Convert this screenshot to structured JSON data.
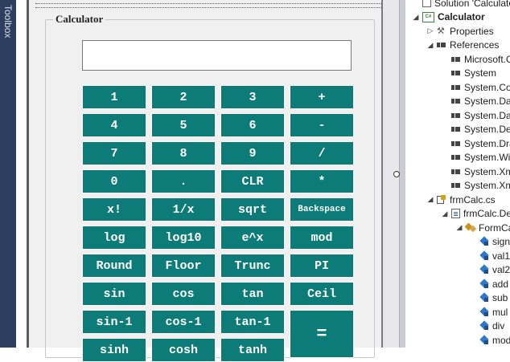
{
  "toolbox": {
    "label": "Toolbox"
  },
  "form": {
    "group_title": "Calculator",
    "display_value": "",
    "button_color": "#0d7b78",
    "buttons": [
      [
        "1",
        "2",
        "3",
        "+"
      ],
      [
        "4",
        "5",
        "6",
        "-"
      ],
      [
        "7",
        "8",
        "9",
        "/"
      ],
      [
        "0",
        ".",
        "CLR",
        "*"
      ],
      [
        "x!",
        "1/x",
        "sqrt",
        "Backspace"
      ],
      [
        "log",
        "log10",
        "e^x",
        "mod"
      ],
      [
        "Round",
        "Floor",
        "Trunc",
        "PI"
      ],
      [
        "sin",
        "cos",
        "tan",
        "Ceil"
      ],
      [
        "sin-1",
        "cos-1",
        "tan-1",
        "="
      ],
      [
        "sinh",
        "cosh",
        "tanh"
      ]
    ]
  },
  "solution_explorer": {
    "items": [
      {
        "label": "Solution 'Calculator'",
        "icon": "solution-icon",
        "indent": 0,
        "expander": ""
      },
      {
        "label": "Calculator",
        "icon": "csharp-project-icon",
        "project_badge": "C#",
        "indent": 0,
        "expander": "open",
        "bold": true
      },
      {
        "label": "Properties",
        "icon": "wrench-icon",
        "indent": 1,
        "expander": "closed"
      },
      {
        "label": "References",
        "icon": "reference-icon",
        "indent": 1,
        "expander": "open"
      },
      {
        "label": "Microsoft.CSharp",
        "icon": "reference-icon",
        "indent": 2,
        "expander": ""
      },
      {
        "label": "System",
        "icon": "reference-icon",
        "indent": 2,
        "expander": ""
      },
      {
        "label": "System.Core",
        "icon": "reference-icon",
        "indent": 2,
        "expander": ""
      },
      {
        "label": "System.Data",
        "icon": "reference-icon",
        "indent": 2,
        "expander": ""
      },
      {
        "label": "System.Data.DataSetExtensions",
        "icon": "reference-icon",
        "indent": 2,
        "expander": ""
      },
      {
        "label": "System.Deployment",
        "icon": "reference-icon",
        "indent": 2,
        "expander": ""
      },
      {
        "label": "System.Drawing",
        "icon": "reference-icon",
        "indent": 2,
        "expander": ""
      },
      {
        "label": "System.Windows.Forms",
        "icon": "reference-icon",
        "indent": 2,
        "expander": ""
      },
      {
        "label": "System.Xml",
        "icon": "reference-icon",
        "indent": 2,
        "expander": ""
      },
      {
        "label": "System.Xml.Linq",
        "icon": "reference-icon",
        "indent": 2,
        "expander": ""
      },
      {
        "label": "frmCalc.cs",
        "icon": "form-file-icon",
        "indent": 1,
        "expander": "open"
      },
      {
        "label": "frmCalc.Designer.cs",
        "icon": "code-file-icon",
        "indent": 2,
        "expander": "open"
      },
      {
        "label": "FormCalc",
        "icon": "class-icon",
        "indent": 3,
        "expander": "open"
      },
      {
        "label": "sign",
        "icon": "field-icon",
        "indent": 4,
        "expander": ""
      },
      {
        "label": "val1",
        "icon": "field-icon",
        "indent": 4,
        "expander": ""
      },
      {
        "label": "val2",
        "icon": "field-icon",
        "indent": 4,
        "expander": ""
      },
      {
        "label": "add",
        "icon": "field-icon",
        "indent": 4,
        "expander": ""
      },
      {
        "label": "sub",
        "icon": "field-icon",
        "indent": 4,
        "expander": ""
      },
      {
        "label": "mul",
        "icon": "field-icon",
        "indent": 4,
        "expander": ""
      },
      {
        "label": "div",
        "icon": "field-icon",
        "indent": 4,
        "expander": ""
      },
      {
        "label": "mod",
        "icon": "field-icon",
        "indent": 4,
        "expander": ""
      }
    ]
  }
}
